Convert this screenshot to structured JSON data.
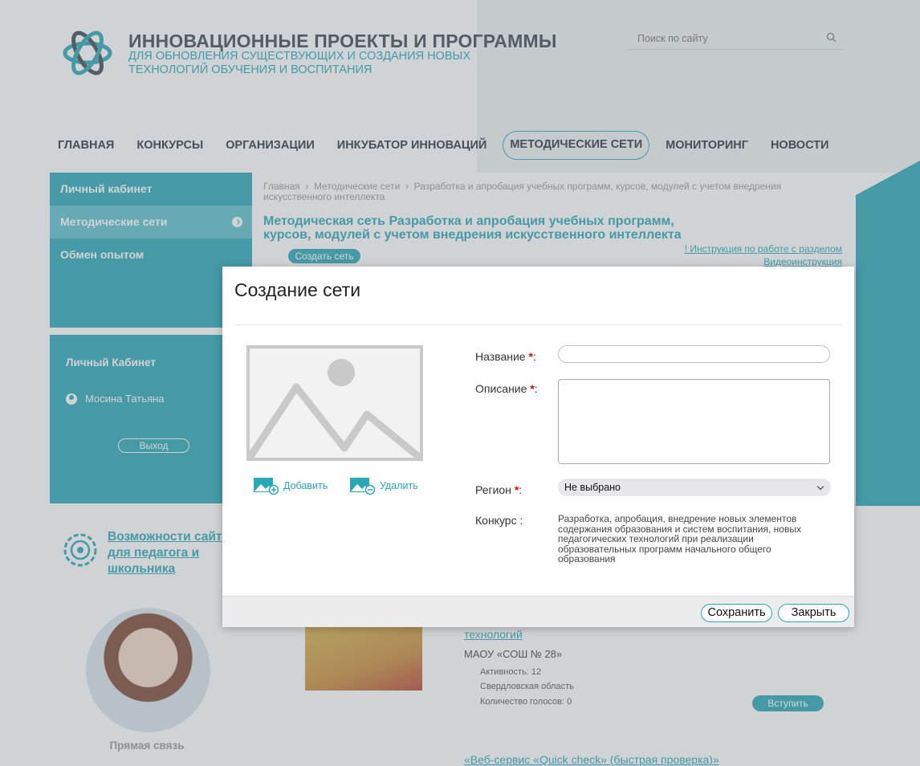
{
  "header": {
    "title": "ИННОВАЦИОННЫЕ ПРОЕКТЫ И ПРОГРАММЫ",
    "subtitle": "ДЛЯ ОБНОВЛЕНИЯ СУЩЕСТВУЮЩИХ И СОЗДАНИЯ НОВЫХ ТЕХНОЛОГИЙ ОБУЧЕНИЯ И ВОСПИТАНИЯ",
    "search_placeholder": "Поиск по сайту"
  },
  "nav": {
    "items": [
      {
        "label": "ГЛАВНАЯ"
      },
      {
        "label": "КОНКУРСЫ"
      },
      {
        "label": "ОРГАНИЗАЦИИ"
      },
      {
        "label": "ИНКУБАТОР ИННОВАЦИЙ"
      },
      {
        "label": "МЕТОДИЧЕСКИЕ СЕТИ"
      },
      {
        "label": "МОНИТОРИНГ"
      },
      {
        "label": "НОВОСТИ"
      }
    ],
    "active": "МЕТОДИЧЕСКИЕ СЕТИ"
  },
  "sidebar": {
    "items": [
      {
        "label": "Личный кабинет"
      },
      {
        "label": "Методические сети"
      },
      {
        "label": "Обмен опытом"
      }
    ],
    "cabinet_title": "Личный Кабинет",
    "user_name": "Мосина Татьяна",
    "logout_label": "Выход",
    "possibilities_link": "Возможности сайта для педагога и школьника",
    "direct_contact": "Прямая связь"
  },
  "main": {
    "breadcrumbs": [
      "Главная",
      "Методические сети",
      "Разработка и апробация учебных программ, курсов, модулей с учетом внедрения искусственного интеллекта"
    ],
    "title": "Методическая сеть Разработка и апробация учебных программ, курсов, модулей с учетом внедрения искусственного интеллекта",
    "create_button": "Создать сеть",
    "instruction_link": "! Инструкция по работе с разделом",
    "video_link": "Видеоинструкция"
  },
  "cards": [
    {
      "title_tail": "технологий",
      "org": "МАОУ «СОШ № 28»",
      "activity": "Активность: 12",
      "region": "Свердловская область",
      "votes": "Количество голосов: 0",
      "join": "Вступить"
    },
    {
      "title": "«Веб-сервис «Quick check» (быстрая проверка)»"
    }
  ],
  "modal": {
    "title": "Создание сети",
    "add_image": "Добавить",
    "remove_image": "Удалить",
    "name_label": "Название",
    "description_label": "Описание",
    "region_label": "Регион",
    "region_value": "Не выбрано",
    "contest_label": "Конкурс :",
    "contest_value": "Разработка, апробация, внедрение новых элементов содержания образования и систем воспитания, новых педагогических технологий при реализации образовательных программ начального общего образования",
    "name_value": "",
    "description_value": "",
    "save_button": "Сохранить",
    "close_button": "Закрыть"
  },
  "colors": {
    "accent": "#2aa8b5",
    "title": "#3f4a52",
    "required": "#ee0000"
  }
}
